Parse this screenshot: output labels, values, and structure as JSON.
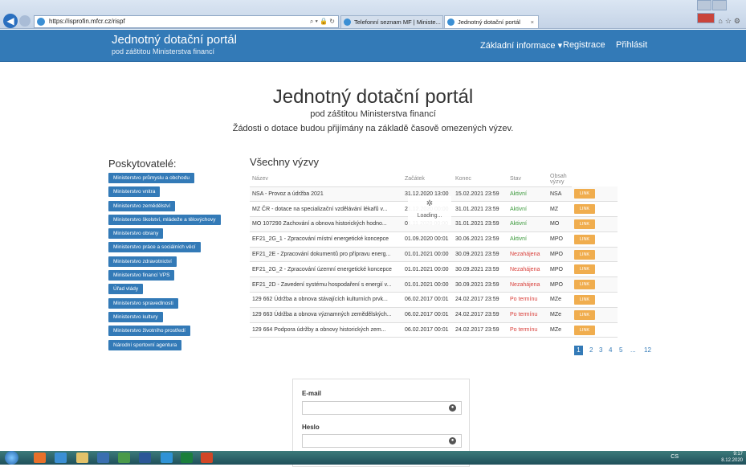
{
  "browser": {
    "url": "https://isprofin.mfcr.cz/rispf",
    "tabs": [
      {
        "label": "Telefonní seznam MF | Ministe..."
      },
      {
        "label": "Jednotný dotační portál",
        "close": "×"
      }
    ]
  },
  "header": {
    "brand_title": "Jednotný dotační portál",
    "brand_subtitle": "pod záštitou Ministerstva financí",
    "menu": {
      "info": "Základní informace ▾",
      "register": "Registrace",
      "login": "Přihlásit"
    }
  },
  "hero": {
    "title": "Jednotný dotační portál",
    "subtitle": "pod záštitou Ministerstva financí",
    "note": "Žádosti o dotace budou přijímány na základě časově omezených výzev."
  },
  "providers": {
    "title": "Poskytovatelé:",
    "items": [
      "Ministerstvo průmyslu a obchodu",
      "Ministerstvo vnitra",
      "Ministerstvo zemědělství",
      "Ministerstvo školství, mládeže a tělovýchovy",
      "Ministerstvo obrany",
      "Ministerstvo práce a sociálních věcí",
      "Ministerstvo zdravotnictví",
      "Ministerstvo financí VPS",
      "Úřad vlády",
      "Ministerstvo spravedlnosti",
      "Ministerstvo kultury",
      "Ministerstvo životního prostředí",
      "Národní sportovní agentura"
    ]
  },
  "calls": {
    "title": "Všechny výzvy",
    "columns": [
      "Název",
      "Začátek",
      "Konec",
      "Stav",
      "Obsah výzvy"
    ],
    "link_label": "LINK",
    "rows": [
      {
        "name": "NSA - Provoz a údržba 2021",
        "start": "31.12.2020 13:00",
        "end": "15.02.2021 23:59",
        "state": "Aktivní",
        "state_type": "active",
        "org": "NSA"
      },
      {
        "name": "MZ ČR - dotace na specializační vzdělávání lékařů v...",
        "start": "21.12.2020 00:00",
        "end": "31.01.2021 23:59",
        "state": "Aktivní",
        "state_type": "active",
        "org": "MZ"
      },
      {
        "name": "MO 107290 Zachování a obnova historických hodno...",
        "start": "01.11.2020 00:00",
        "end": "31.01.2021 23:59",
        "state": "Aktivní",
        "state_type": "active",
        "org": "MO"
      },
      {
        "name": "EF21_2G_1 - Zpracování místní energetické koncepce",
        "start": "01.09.2020 00:01",
        "end": "30.06.2021 23:59",
        "state": "Aktivní",
        "state_type": "active",
        "org": "MPO"
      },
      {
        "name": "EF21_2E - Zpracování dokumentů pro přípravu energ...",
        "start": "01.01.2021 00:00",
        "end": "30.09.2021 23:59",
        "state": "Nezahájena",
        "state_type": "red",
        "org": "MPO"
      },
      {
        "name": "EF21_2G_2 - Zpracování územní energetické koncepce",
        "start": "01.01.2021 00:00",
        "end": "30.09.2021 23:59",
        "state": "Nezahájena",
        "state_type": "red",
        "org": "MPO"
      },
      {
        "name": "EF21_2D - Zavedení systému hospodaření s energií v...",
        "start": "01.01.2021 00:00",
        "end": "30.09.2021 23:59",
        "state": "Nezahájena",
        "state_type": "red",
        "org": "MPO"
      },
      {
        "name": "129 662 Údržba a obnova stávajících kulturních prvk...",
        "start": "06.02.2017 00:01",
        "end": "24.02.2017 23:59",
        "state": "Po termínu",
        "state_type": "red",
        "org": "MZe"
      },
      {
        "name": "129 663 Údržba a obnova významných zemědělských...",
        "start": "06.02.2017 00:01",
        "end": "24.02.2017 23:59",
        "state": "Po termínu",
        "state_type": "red",
        "org": "MZe"
      },
      {
        "name": "129 664 Podpora údržby a obnovy historických zem...",
        "start": "06.02.2017 00:01",
        "end": "24.02.2017 23:59",
        "state": "Po termínu",
        "state_type": "red",
        "org": "MZe"
      }
    ],
    "loading": "Loading...",
    "pagination": [
      "1",
      "2",
      "3",
      "4",
      "5",
      "...",
      "12"
    ]
  },
  "login": {
    "email_label": "E-mail",
    "password_label": "Heslo"
  },
  "taskbar": {
    "lang": "CS",
    "time": "9:17",
    "date": "8.12.2020"
  }
}
